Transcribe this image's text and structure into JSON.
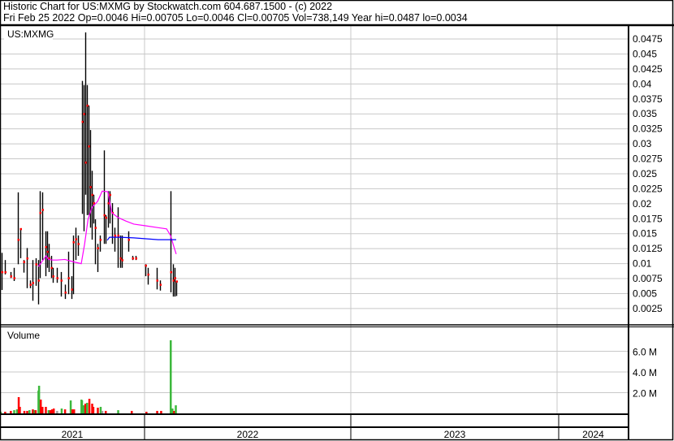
{
  "header": {
    "title": "Historic Chart for US:MXMG by Stockwatch.com 604.687.1500 - (c) 2022",
    "quote": "Fri Feb 25 2022   Op=0.0046   Hi=0.00705   Lo=0.0046   Cl=0.00705   Vol=738,149   Year hi=0.0487   lo=0.0034"
  },
  "colors": {
    "bar": "#000000",
    "down": "#ff0000",
    "up": "#3cb83c",
    "flat": "#a0a0a0",
    "ma_short": "#ff00ff",
    "ma_long": "#0000ff",
    "grid": "#c8c8c8"
  },
  "chart_data": [
    {
      "type": "line",
      "title": "US:MXMG",
      "x_unit": "days since 2021-01-01",
      "ylim": [
        0,
        0.05
      ],
      "y_ticks": [
        "0.0025",
        "0.005",
        "0.0075",
        "0.01",
        "0.0125",
        "0.015",
        "0.0175",
        "0.02",
        "0.0225",
        "0.025",
        "0.0275",
        "0.03",
        "0.0325",
        "0.035",
        "0.0375",
        "0.04",
        "0.0425",
        "0.045",
        "0.0475"
      ],
      "grid": true,
      "ohlc_bars": [
        [
          112,
          0.0118,
          0.0056,
          0.0086
        ],
        [
          118,
          0.0106,
          0.0082,
          0.0086
        ],
        [
          128,
          0.0086,
          0.0076,
          0.0079
        ],
        [
          134,
          0.0093,
          0.0071,
          0.0076
        ],
        [
          141,
          0.0219,
          0.0099,
          0.014
        ],
        [
          145,
          0.0158,
          0.0109,
          0.0158
        ],
        [
          151,
          0.0106,
          0.0085,
          0.0103
        ],
        [
          157,
          0.0126,
          0.0059,
          0.0109
        ],
        [
          162,
          0.0072,
          0.0059,
          0.0065
        ],
        [
          167,
          0.0106,
          0.0038,
          0.0068
        ],
        [
          172,
          0.0109,
          0.0063,
          0.0099
        ],
        [
          177,
          0.0106,
          0.0032,
          0.0072
        ],
        [
          180,
          0.0221,
          0.0076,
          0.0185
        ],
        [
          184,
          0.0219,
          0.0106,
          0.019
        ],
        [
          190,
          0.0154,
          0.0079,
          0.0128
        ],
        [
          193,
          0.0154,
          0.0093,
          0.012
        ],
        [
          195,
          0.0133,
          0.0086,
          0.0109
        ],
        [
          200,
          0.0113,
          0.0076,
          0.0093
        ],
        [
          203,
          0.0093,
          0.0068,
          0.0079
        ],
        [
          210,
          0.0093,
          0.0068,
          0.0076
        ],
        [
          217,
          0.0086,
          0.0045,
          0.0072
        ],
        [
          224,
          0.0065,
          0.0041,
          0.0052
        ],
        [
          230,
          0.012,
          0.0049,
          0.0076
        ],
        [
          236,
          0.0079,
          0.0041,
          0.0057
        ],
        [
          239,
          0.0147,
          0.0049,
          0.0136
        ],
        [
          243,
          0.016,
          0.0106,
          0.0141
        ],
        [
          247,
          0.0147,
          0.0113,
          0.0133
        ],
        [
          254,
          0.0405,
          0.0183,
          0.0337
        ],
        [
          257,
          0.0398,
          0.0154,
          0.035
        ],
        [
          260,
          0.0486,
          0.0215,
          0.0269
        ],
        [
          263,
          0.0398,
          0.0181,
          0.0364
        ],
        [
          266,
          0.0364,
          0.0181,
          0.0296
        ],
        [
          269,
          0.0323,
          0.016,
          0.0228
        ],
        [
          272,
          0.0255,
          0.014,
          0.0215
        ],
        [
          274,
          0.0215,
          0.0167,
          0.0201
        ],
        [
          277,
          0.0174,
          0.0099,
          0.016
        ],
        [
          282,
          0.0133,
          0.0086,
          0.0126
        ],
        [
          286,
          0.0147,
          0.012,
          0.014
        ],
        [
          293,
          0.0289,
          0.0133,
          0.0181
        ],
        [
          296,
          0.0181,
          0.0133,
          0.0177
        ],
        [
          300,
          0.0221,
          0.016,
          0.0201
        ],
        [
          303,
          0.0221,
          0.0167,
          0.0215
        ],
        [
          307,
          0.0201,
          0.0133,
          0.0185
        ],
        [
          312,
          0.016,
          0.012,
          0.0147
        ],
        [
          318,
          0.0194,
          0.0093,
          0.0147
        ],
        [
          322,
          0.0147,
          0.0093,
          0.0109
        ],
        [
          325,
          0.0147,
          0.0093,
          0.0106
        ],
        [
          336,
          0.0154,
          0.012,
          0.014
        ],
        [
          343,
          0.0113,
          0.0106,
          0.0109
        ],
        [
          349,
          0.0113,
          0.0106,
          0.0109
        ],
        [
          366,
          0.0099,
          0.0079,
          0.0097
        ],
        [
          371,
          0.0093,
          0.0065,
          0.0082
        ],
        [
          387,
          0.0093,
          0.0057,
          0.0072
        ],
        [
          392,
          0.0072,
          0.0055,
          0.0065
        ],
        [
          411,
          0.0221,
          0.0052,
          0.0086
        ],
        [
          415,
          0.0099,
          0.0045,
          0.0072
        ],
        [
          418,
          0.0093,
          0.0045,
          0.0076
        ],
        [
          421,
          0.00705,
          0.0046,
          0.00705
        ]
      ],
      "series": [
        {
          "name": "moving average short",
          "color": "#ff00ff",
          "points": [
            [
              177,
              0.0095
            ],
            [
              191,
              0.0113
            ],
            [
              195,
              0.0107
            ],
            [
              203,
              0.0106
            ],
            [
              210,
              0.0106
            ],
            [
              224,
              0.0107
            ],
            [
              239,
              0.0103
            ],
            [
              253,
              0.01
            ],
            [
              259,
              0.0133
            ],
            [
              265,
              0.0174
            ],
            [
              272,
              0.0194
            ],
            [
              282,
              0.0204
            ],
            [
              290,
              0.0221
            ],
            [
              300,
              0.022
            ],
            [
              307,
              0.0185
            ],
            [
              318,
              0.0177
            ],
            [
              332,
              0.0171
            ],
            [
              346,
              0.0166
            ],
            [
              368,
              0.0163
            ],
            [
              389,
              0.016
            ],
            [
              404,
              0.0158
            ],
            [
              411,
              0.0147
            ],
            [
              417,
              0.0128
            ],
            [
              421,
              0.0116
            ]
          ]
        },
        {
          "name": "moving average long",
          "color": "#0000ff",
          "points": [
            [
              299,
              0.0139
            ],
            [
              303,
              0.0144
            ],
            [
              322,
              0.0144
            ],
            [
              346,
              0.0143
            ],
            [
              389,
              0.014
            ],
            [
              421,
              0.014
            ]
          ]
        }
      ]
    },
    {
      "type": "bar",
      "title": "Volume",
      "ylim": [
        0,
        7.5
      ],
      "y_ticks": [
        "2.0 M",
        "4.0 M",
        "6.0 M"
      ],
      "y_tick_values": [
        2,
        4,
        6
      ],
      "bars": [
        [
          110,
          0.16,
          "up"
        ],
        [
          118,
          0.16,
          "down"
        ],
        [
          128,
          0.24,
          "down"
        ],
        [
          134,
          0.31,
          "up"
        ],
        [
          139,
          0.39,
          "up"
        ],
        [
          142,
          1.57,
          "down"
        ],
        [
          144,
          0.63,
          "down"
        ],
        [
          152,
          0.24,
          "down"
        ],
        [
          157,
          0.24,
          "down"
        ],
        [
          161,
          0.31,
          "up"
        ],
        [
          167,
          0.39,
          "down"
        ],
        [
          170,
          0.31,
          "up"
        ],
        [
          172,
          0.31,
          "down"
        ],
        [
          177,
          2.2,
          "up"
        ],
        [
          178,
          2.67,
          "up"
        ],
        [
          181,
          1.33,
          "down"
        ],
        [
          184,
          0.63,
          "down"
        ],
        [
          190,
          0.63,
          "down"
        ],
        [
          195,
          0.31,
          "up"
        ],
        [
          198,
          0.31,
          "down"
        ],
        [
          201,
          0.39,
          "down"
        ],
        [
          204,
          0.47,
          "down"
        ],
        [
          210,
          0.24,
          "flat"
        ],
        [
          218,
          0.47,
          "up"
        ],
        [
          224,
          0.39,
          "down"
        ],
        [
          234,
          1.25,
          "up"
        ],
        [
          237,
          0.39,
          "down"
        ],
        [
          240,
          0.39,
          "down"
        ],
        [
          253,
          1.33,
          "up"
        ],
        [
          254,
          1.25,
          "up"
        ],
        [
          257,
          0.78,
          "up"
        ],
        [
          260,
          0.94,
          "down"
        ],
        [
          263,
          1.02,
          "up"
        ],
        [
          267,
          1.41,
          "down"
        ],
        [
          272,
          0.94,
          "down"
        ],
        [
          274,
          0.63,
          "down"
        ],
        [
          282,
          0.55,
          "down"
        ],
        [
          287,
          0.63,
          "up"
        ],
        [
          290,
          0.24,
          "flat"
        ],
        [
          296,
          0.24,
          "down"
        ],
        [
          318,
          0.31,
          "up"
        ],
        [
          342,
          0.24,
          "down"
        ],
        [
          368,
          0.16,
          "down"
        ],
        [
          387,
          0.24,
          "down"
        ],
        [
          394,
          0.24,
          "down"
        ],
        [
          411,
          7.06,
          "up"
        ],
        [
          414,
          0.47,
          "up"
        ],
        [
          417,
          0.24,
          "down"
        ],
        [
          420,
          0.78,
          "up"
        ]
      ]
    }
  ],
  "x_axis": {
    "years": [
      "2021",
      "2022",
      "2023",
      "2024"
    ]
  }
}
